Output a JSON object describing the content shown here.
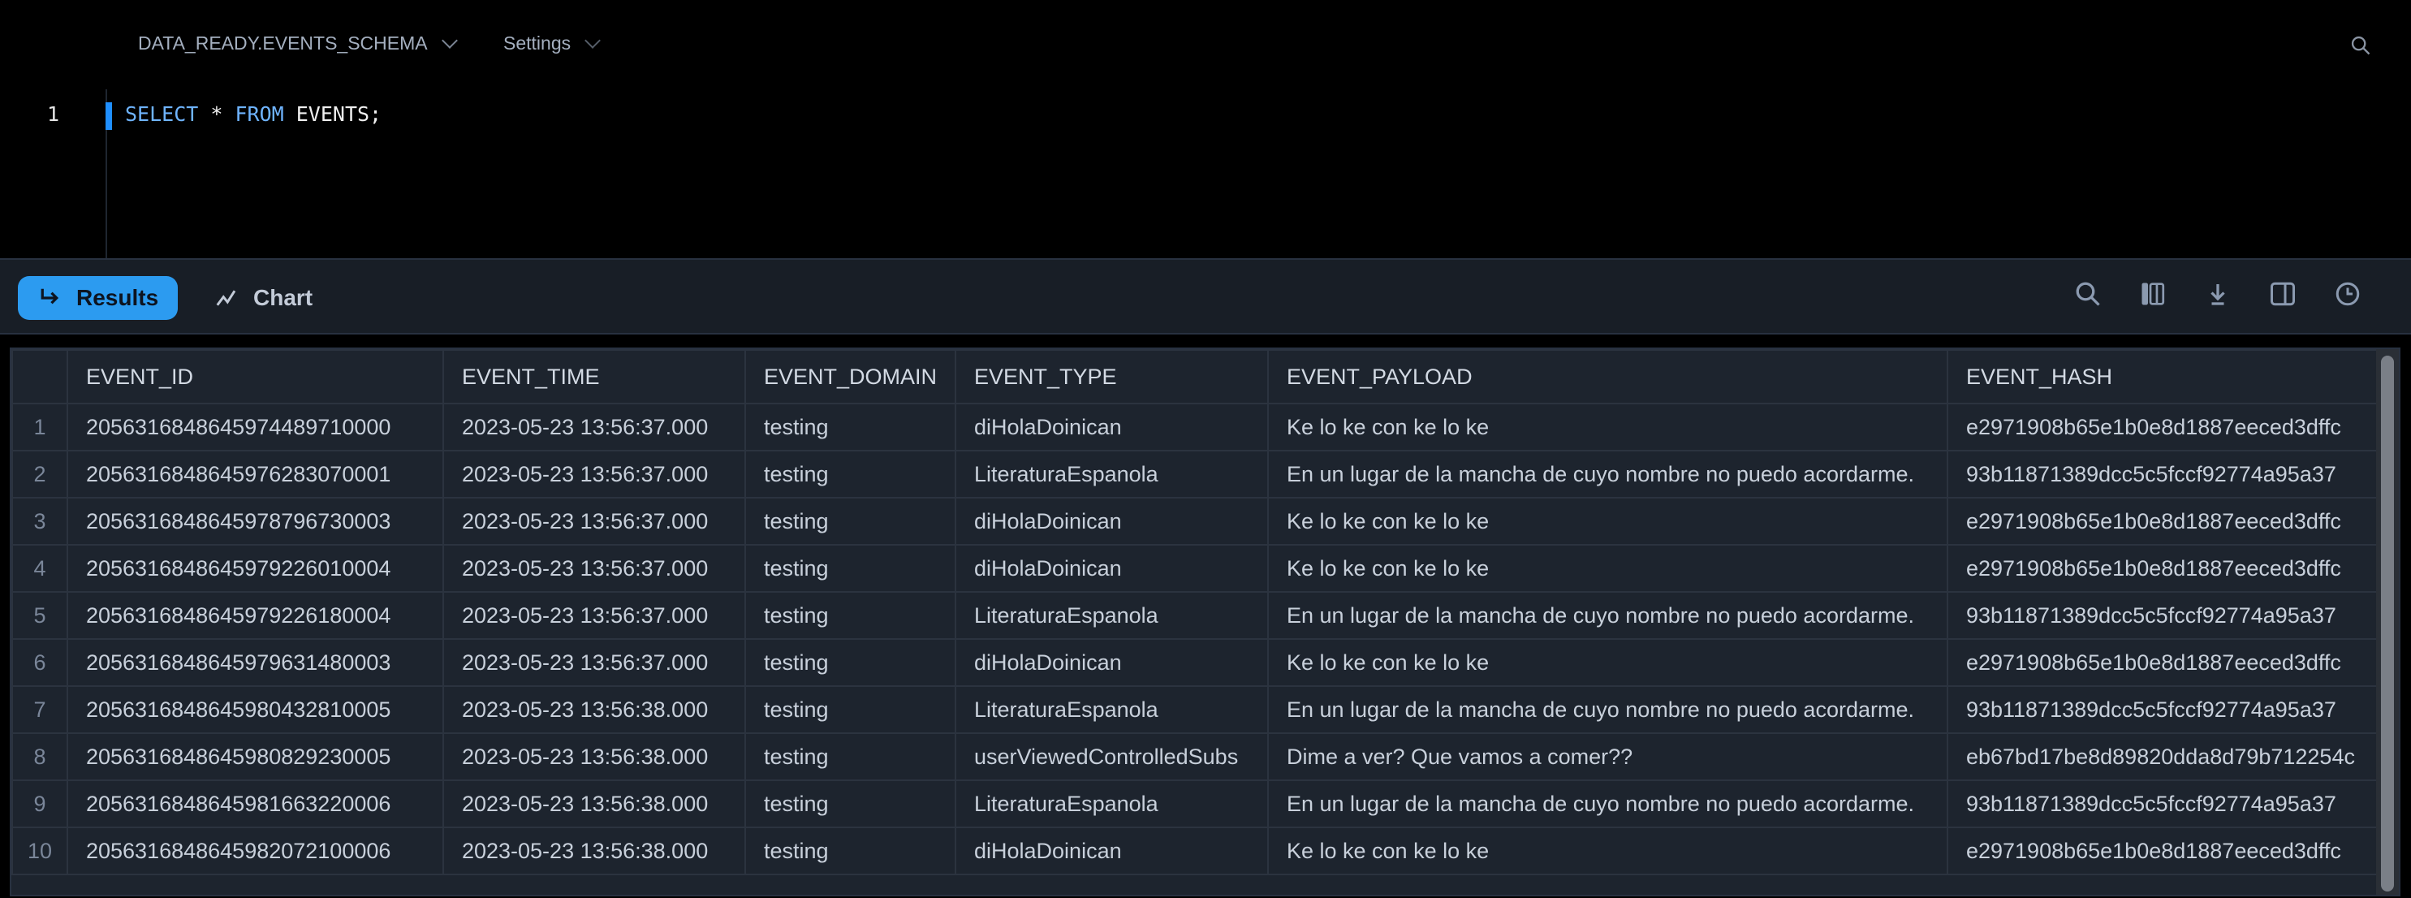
{
  "topbar": {
    "context": "DATA_READY.EVENTS_SCHEMA",
    "settings": "Settings"
  },
  "editor": {
    "line_number": "1",
    "kw1": "SELECT",
    "star": " * ",
    "kw2": "FROM",
    "rest": " EVENTS;"
  },
  "toolbar": {
    "results": "Results",
    "chart": "Chart",
    "accent": "#2c9bf0"
  },
  "table": {
    "columns": [
      "EVENT_ID",
      "EVENT_TIME",
      "EVENT_DOMAIN",
      "EVENT_TYPE",
      "EVENT_PAYLOAD",
      "EVENT_HASH"
    ],
    "rows": [
      [
        "1",
        "205631684864597448971000​0",
        "2023-05-23 13:56:37.000",
        "testing",
        "diHolaDoinican",
        "Ke lo ke con ke lo ke",
        "e2971908b65e1b0e8d1887eeced3dffc"
      ],
      [
        "2",
        "2056316848645976283070001",
        "2023-05-23 13:56:37.000",
        "testing",
        "LiteraturaEspanola",
        "En un lugar de la mancha de cuyo nombre no puedo acordarme.",
        "93b11871389dcc5c5fccf92774a95a37"
      ],
      [
        "3",
        "2056316848645978796730003",
        "2023-05-23 13:56:37.000",
        "testing",
        "diHolaDoinican",
        "Ke lo ke con ke lo ke",
        "e2971908b65e1b0e8d1887eeced3dffc"
      ],
      [
        "4",
        "2056316848645979226010004",
        "2023-05-23 13:56:37.000",
        "testing",
        "diHolaDoinican",
        "Ke lo ke con ke lo ke",
        "e2971908b65e1b0e8d1887eeced3dffc"
      ],
      [
        "5",
        "2056316848645979226180004",
        "2023-05-23 13:56:37.000",
        "testing",
        "LiteraturaEspanola",
        "En un lugar de la mancha de cuyo nombre no puedo acordarme.",
        "93b11871389dcc5c5fccf92774a95a37"
      ],
      [
        "6",
        "2056316848645979631480003",
        "2023-05-23 13:56:37.000",
        "testing",
        "diHolaDoinican",
        "Ke lo ke con ke lo ke",
        "e2971908b65e1b0e8d1887eeced3dffc"
      ],
      [
        "7",
        "2056316848645980432810005",
        "2023-05-23 13:56:38.000",
        "testing",
        "LiteraturaEspanola",
        "En un lugar de la mancha de cuyo nombre no puedo acordarme.",
        "93b11871389dcc5c5fccf92774a95a37"
      ],
      [
        "8",
        "2056316848645980829230005",
        "2023-05-23 13:56:38.000",
        "testing",
        "userViewedControlledSubs",
        "Dime a ver?  Que vamos a comer??",
        "eb67bd17be8d89820dda8d79b712254c"
      ],
      [
        "9",
        "2056316848645981663220006",
        "2023-05-23 13:56:38.000",
        "testing",
        "LiteraturaEspanola",
        "En un lugar de la mancha de cuyo nombre no puedo acordarme.",
        "93b11871389dcc5c5fccf92774a95a37"
      ],
      [
        "10",
        "2056316848645982072100006",
        "2023-05-23 13:56:38.000",
        "testing",
        "diHolaDoinican",
        "Ke lo ke con ke lo ke",
        "e2971908b65e1b0e8d1887eeced3dffc"
      ]
    ]
  }
}
